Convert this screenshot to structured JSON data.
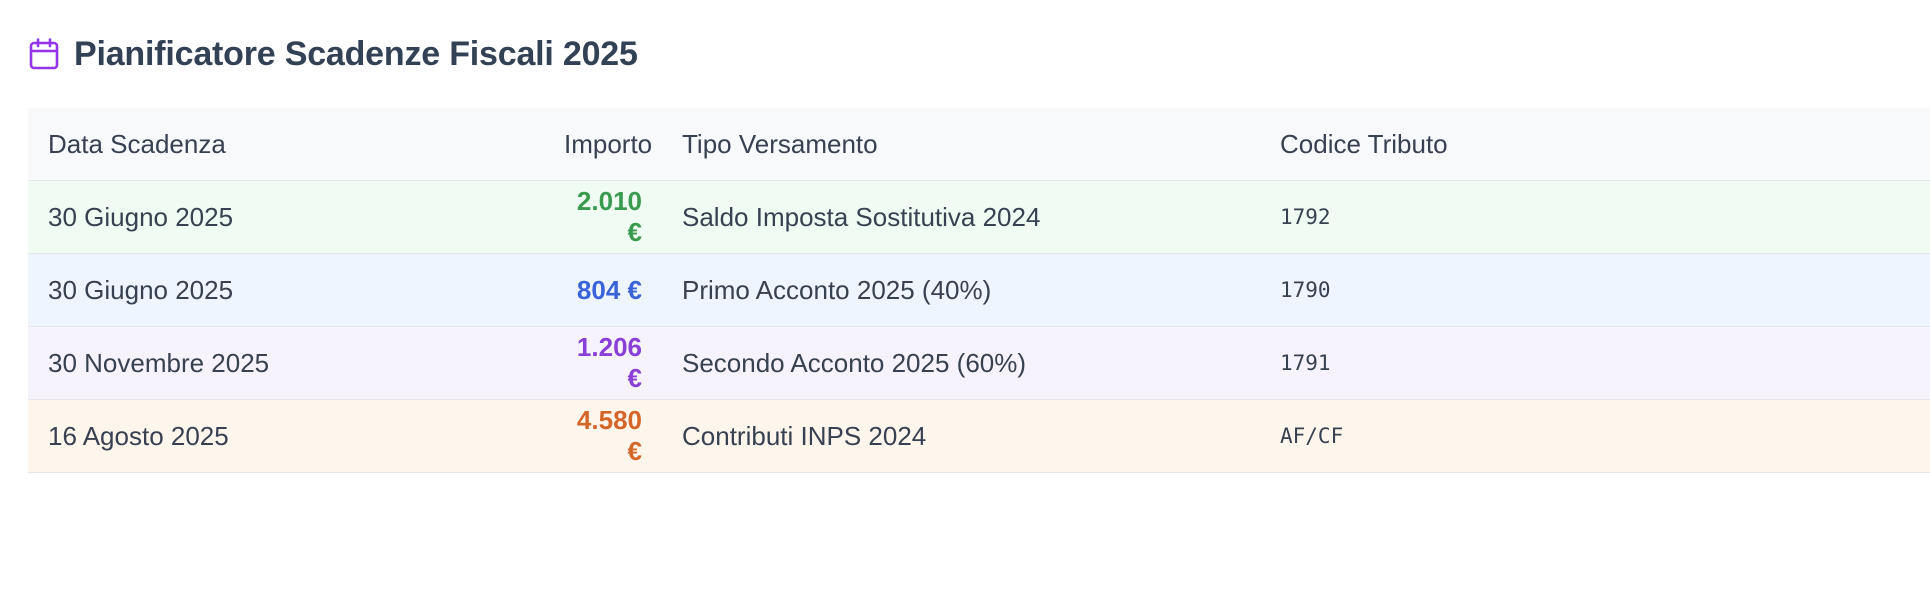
{
  "header": {
    "icon": "calendar-icon",
    "title": "Pianificatore Scadenze Fiscali 2025"
  },
  "table": {
    "columns": [
      "Data Scadenza",
      "Importo",
      "Tipo Versamento",
      "Codice Tributo"
    ],
    "rows": [
      {
        "date": "30 Giugno 2025",
        "amount": "2.010 €",
        "type": "Saldo Imposta Sostitutiva 2024",
        "code": "1792",
        "amount_color": "#3a9a4f",
        "row_bg": "#f0fbf3"
      },
      {
        "date": "30 Giugno 2025",
        "amount": "804 €",
        "type": "Primo Acconto 2025 (40%)",
        "code": "1790",
        "amount_color": "#3b63d9",
        "row_bg": "#eef5fe"
      },
      {
        "date": "30 Novembre 2025",
        "amount": "1.206 €",
        "type": "Secondo Acconto 2025 (60%)",
        "code": "1791",
        "amount_color": "#8a3fd6",
        "row_bg": "#f6f3fd"
      },
      {
        "date": "16 Agosto 2025",
        "amount": "4.580 €",
        "type": "Contributi INPS 2024",
        "code": "AF/CF",
        "amount_color": "#d5662a",
        "row_bg": "#fef6ec"
      }
    ]
  },
  "colors": {
    "accent_icon": "#9333ea",
    "title": "#334155"
  }
}
